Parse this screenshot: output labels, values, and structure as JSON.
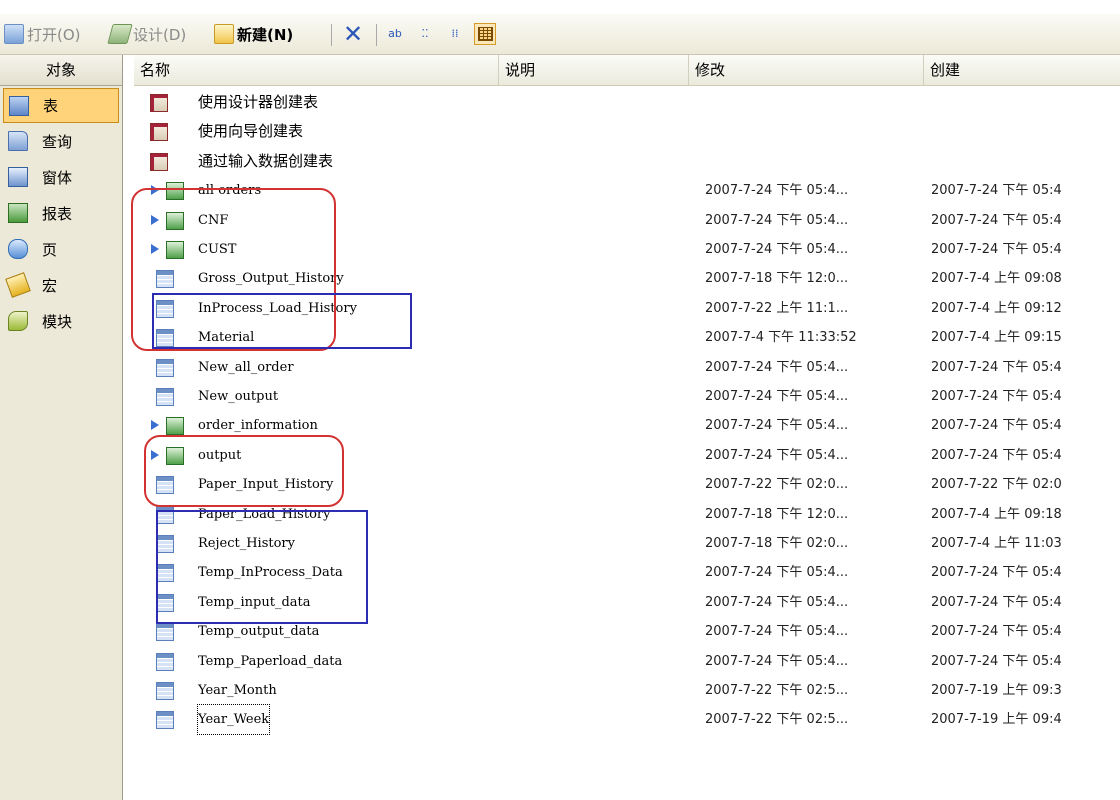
{
  "toolbar": {
    "open_label": "打开(O)",
    "design_label": "设计(D)",
    "new_label": "新建(N)"
  },
  "objects": {
    "header": "对象",
    "items": [
      {
        "label": "表",
        "icon": "table-icon"
      },
      {
        "label": "查询",
        "icon": "query-icon"
      },
      {
        "label": "窗体",
        "icon": "form-icon"
      },
      {
        "label": "报表",
        "icon": "report-icon"
      },
      {
        "label": "页",
        "icon": "page-icon"
      },
      {
        "label": "宏",
        "icon": "macro-icon"
      },
      {
        "label": "模块",
        "icon": "module-icon"
      }
    ],
    "selected": "表"
  },
  "columns": {
    "name": "名称",
    "description": "说明",
    "modified": "修改",
    "created": "创建"
  },
  "rows": [
    {
      "name": "使用设计器创建表",
      "type": "shortcut",
      "modified": "",
      "created": ""
    },
    {
      "name": "使用向导创建表",
      "type": "shortcut",
      "modified": "",
      "created": ""
    },
    {
      "name": "通过输入数据创建表",
      "type": "shortcut",
      "modified": "",
      "created": ""
    },
    {
      "name": "all orders",
      "type": "linked",
      "modified": "2007-7-24 下午 05:4...",
      "created": "2007-7-24 下午 05:4"
    },
    {
      "name": "CNF",
      "type": "linked",
      "modified": "2007-7-24 下午 05:4...",
      "created": "2007-7-24 下午 05:4"
    },
    {
      "name": "CUST",
      "type": "linked",
      "modified": "2007-7-24 下午 05:4...",
      "created": "2007-7-24 下午 05:4"
    },
    {
      "name": "Gross_Output_History",
      "type": "table",
      "modified": "2007-7-18 下午 12:0...",
      "created": "2007-7-4 上午 09:08"
    },
    {
      "name": "InProcess_Load_History",
      "type": "table",
      "modified": "2007-7-22 上午 11:1...",
      "created": "2007-7-4 上午 09:12"
    },
    {
      "name": "Material",
      "type": "table",
      "modified": "2007-7-4 下午 11:33:52",
      "created": "2007-7-4 上午 09:15"
    },
    {
      "name": "New_all_order",
      "type": "table",
      "modified": "2007-7-24 下午 05:4...",
      "created": "2007-7-24 下午 05:4"
    },
    {
      "name": "New_output",
      "type": "table",
      "modified": "2007-7-24 下午 05:4...",
      "created": "2007-7-24 下午 05:4"
    },
    {
      "name": "order_information",
      "type": "linked",
      "modified": "2007-7-24 下午 05:4...",
      "created": "2007-7-24 下午 05:4"
    },
    {
      "name": "output",
      "type": "linked",
      "modified": "2007-7-24 下午 05:4...",
      "created": "2007-7-24 下午 05:4"
    },
    {
      "name": "Paper_Input_History",
      "type": "table",
      "modified": "2007-7-22 下午 02:0...",
      "created": "2007-7-22 下午 02:0"
    },
    {
      "name": "Paper_Load_History",
      "type": "table",
      "modified": "2007-7-18 下午 12:0...",
      "created": "2007-7-4 上午 09:18"
    },
    {
      "name": "Reject_History",
      "type": "table",
      "modified": "2007-7-18 下午 02:0...",
      "created": "2007-7-4 上午 11:03"
    },
    {
      "name": "Temp_InProcess_Data",
      "type": "table",
      "modified": "2007-7-24 下午 05:4...",
      "created": "2007-7-24 下午 05:4"
    },
    {
      "name": "Temp_input_data",
      "type": "table",
      "modified": "2007-7-24 下午 05:4...",
      "created": "2007-7-24 下午 05:4"
    },
    {
      "name": "Temp_output_data",
      "type": "table",
      "modified": "2007-7-24 下午 05:4...",
      "created": "2007-7-24 下午 05:4"
    },
    {
      "name": "Temp_Paperload_data",
      "type": "table",
      "modified": "2007-7-24 下午 05:4...",
      "created": "2007-7-24 下午 05:4"
    },
    {
      "name": "Year_Month",
      "type": "table",
      "modified": "2007-7-22 下午 02:5...",
      "created": "2007-7-19 上午 09:3"
    },
    {
      "name": "Year_Week",
      "type": "table",
      "modified": "2007-7-22 下午 02:5...",
      "created": "2007-7-19 上午 09:4"
    }
  ],
  "colors": {
    "toolbar_bg": "#ece9d8",
    "selected_bg": "#ffd37a",
    "annotation_red": "#d33232",
    "annotation_blue": "#2d2db3",
    "link_arrow": "#3a6fd0"
  }
}
